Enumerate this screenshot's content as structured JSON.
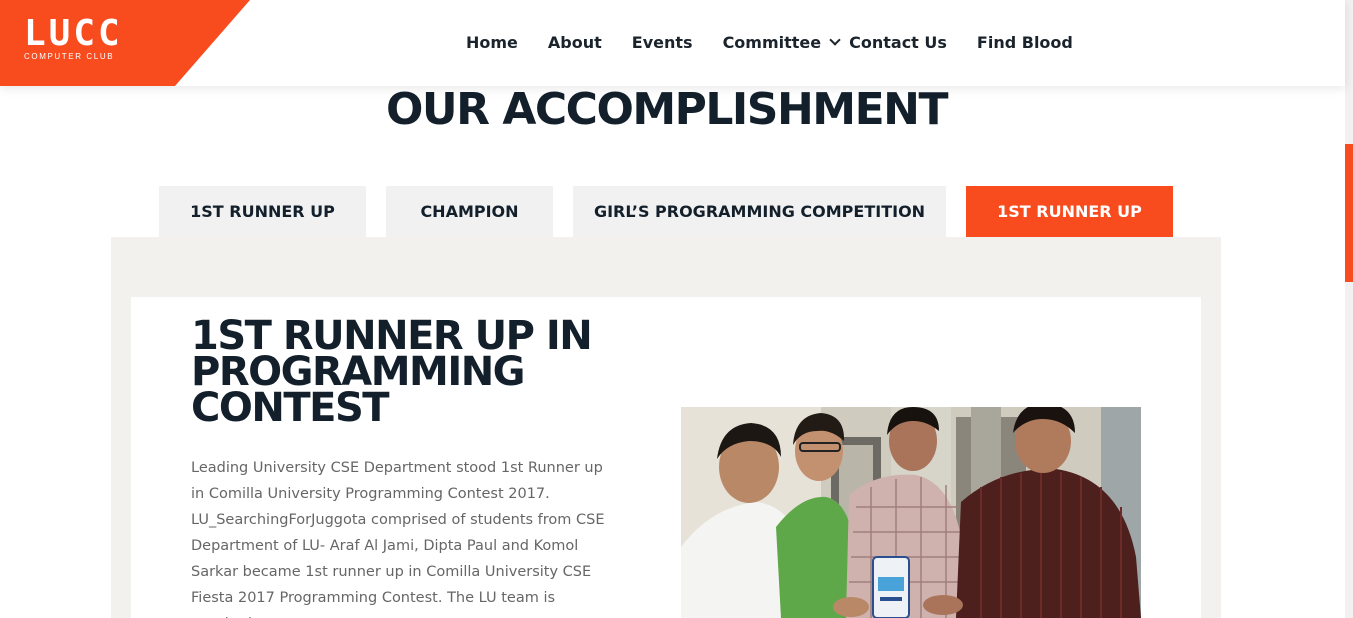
{
  "logo": {
    "mark": "LUCC",
    "subtitle": "COMPUTER CLUB"
  },
  "nav": {
    "items": [
      "Home",
      "About",
      "Events",
      "Committee",
      "Contact Us",
      "Find Blood"
    ]
  },
  "section": {
    "title": "OUR ACCOMPLISHMENT"
  },
  "tabs": [
    {
      "label": "1ST RUNNER UP",
      "active": false
    },
    {
      "label": "CHAMPION",
      "active": false
    },
    {
      "label": "GIRL’S PROGRAMMING COMPETITION",
      "active": false
    },
    {
      "label": "1ST RUNNER UP",
      "active": true
    }
  ],
  "content": {
    "title": "1ST RUNNER UP IN PROGRAMMING CONTEST",
    "text": "Leading University CSE Department stood 1st Runner up in Comilla University Programming Contest 2017. LU_SearchingForJuggota comprised of students from CSE Department of LU- Araf Al Jami, Dipta Paul and Komol Sarkar became 1st runner up in Comilla University CSE Fiesta 2017 Programming Contest. The LU team is coached"
  },
  "colors": {
    "accent": "#f84c1f",
    "heading": "#13202b",
    "panel": "#f2f1ee",
    "tab": "#f1f1f1"
  },
  "icons": {
    "committee_dropdown": "chevron-down-icon"
  }
}
